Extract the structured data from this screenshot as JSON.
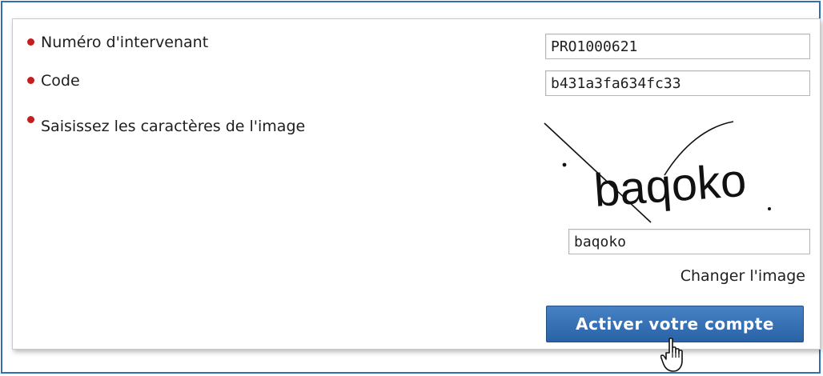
{
  "form": {
    "fields": [
      {
        "label": "Numéro d'intervenant",
        "value": "PRO1000621"
      },
      {
        "label": "Code",
        "value": "b431a3fa634fc33"
      },
      {
        "label": "Saisissez les caractères de l'image",
        "value": "baqoko"
      }
    ],
    "captcha": {
      "text": "baqoko"
    },
    "change_image_label": "Changer l'image",
    "submit_label": "Activer votre compte"
  },
  "colors": {
    "frame_border": "#2f6fb2",
    "bullet": "#c31f1f",
    "button_top": "#4682c4",
    "button_bottom": "#2a62a6"
  },
  "icons": {
    "required_marker": "red-dot-icon",
    "pointer": "hand-pointer-icon"
  }
}
